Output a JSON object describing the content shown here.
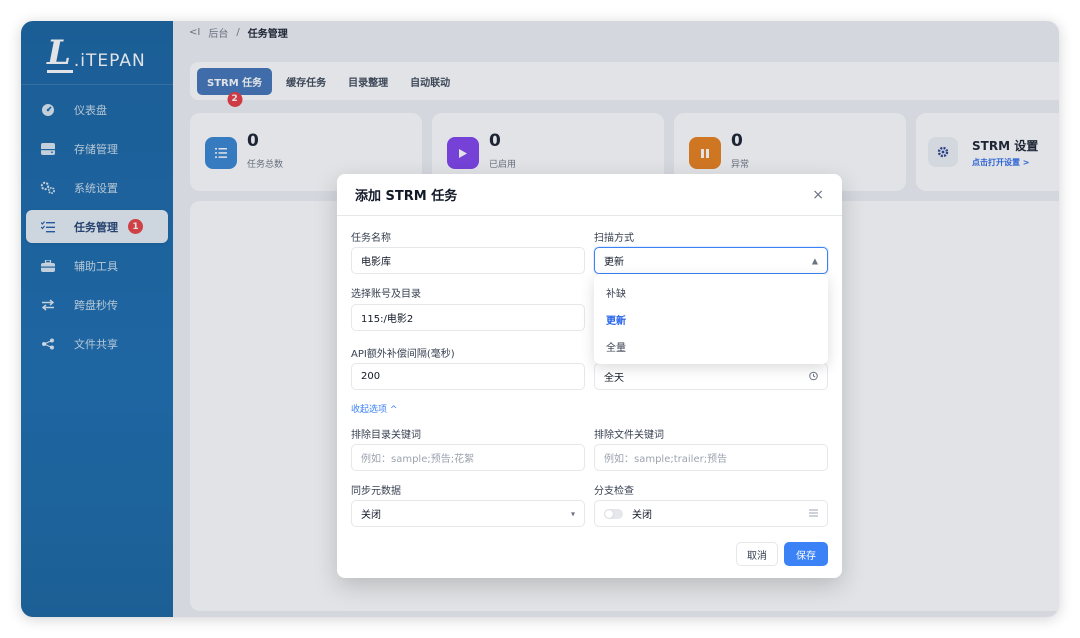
{
  "app": {
    "logo_mark": "L",
    "logo_text": ".iTEPAN"
  },
  "sidebar": {
    "items": [
      {
        "label": "仪表盘",
        "icon": "dashboard-icon"
      },
      {
        "label": "存储管理",
        "icon": "storage-icon"
      },
      {
        "label": "系统设置",
        "icon": "gears-icon"
      },
      {
        "label": "任务管理",
        "icon": "task-list-icon",
        "active": true,
        "badge": "1"
      },
      {
        "label": "辅助工具",
        "icon": "toolbox-icon"
      },
      {
        "label": "跨盘秒传",
        "icon": "transfer-icon"
      },
      {
        "label": "文件共享",
        "icon": "share-icon"
      }
    ]
  },
  "breadcrumb": {
    "back": "<I",
    "parent": "后台",
    "separator": "/",
    "current": "任务管理"
  },
  "tabs": [
    {
      "label": "STRM 任务",
      "active": true,
      "badge": "2"
    },
    {
      "label": "缓存任务"
    },
    {
      "label": "目录整理"
    },
    {
      "label": "自动联动"
    }
  ],
  "stats": [
    {
      "value": "0",
      "label": "任务总数",
      "color": "#2f80d1",
      "icon": "list-icon"
    },
    {
      "value": "0",
      "label": "已启用",
      "color": "#7c3aed",
      "icon": "play-icon"
    },
    {
      "value": "0",
      "label": "异常",
      "color": "#ea7a12",
      "icon": "pause-icon"
    }
  ],
  "strm_settings": {
    "title": "STRM 设置",
    "link": "点击打开设置 >",
    "icon": "settings-gear-icon"
  },
  "modal": {
    "title": "添加 STRM 任务",
    "close": "×",
    "task_name_label": "任务名称",
    "task_name_value": "电影库",
    "scan_mode_label": "扫描方式",
    "scan_mode_value": "更新",
    "scan_mode_options": [
      "补缺",
      "更新",
      "全量"
    ],
    "account_label": "选择账号及目录",
    "account_value": "115:/电影2",
    "api_interval_label": "API额外补偿间隔(毫秒)",
    "api_interval_value": "200",
    "schedule_value": "全天",
    "collapse_label": "收起选项 ^",
    "exclude_dir_label": "排除目录关键词",
    "exclude_dir_placeholder": "例如：sample;预告;花絮",
    "exclude_file_label": "排除文件关键词",
    "exclude_file_placeholder": "例如：sample;trailer;预告",
    "sync_meta_label": "同步元数据",
    "sync_meta_value": "关闭",
    "branch_check_label": "分支检查",
    "branch_check_value": "关闭",
    "cancel_label": "取消",
    "save_label": "保存"
  }
}
